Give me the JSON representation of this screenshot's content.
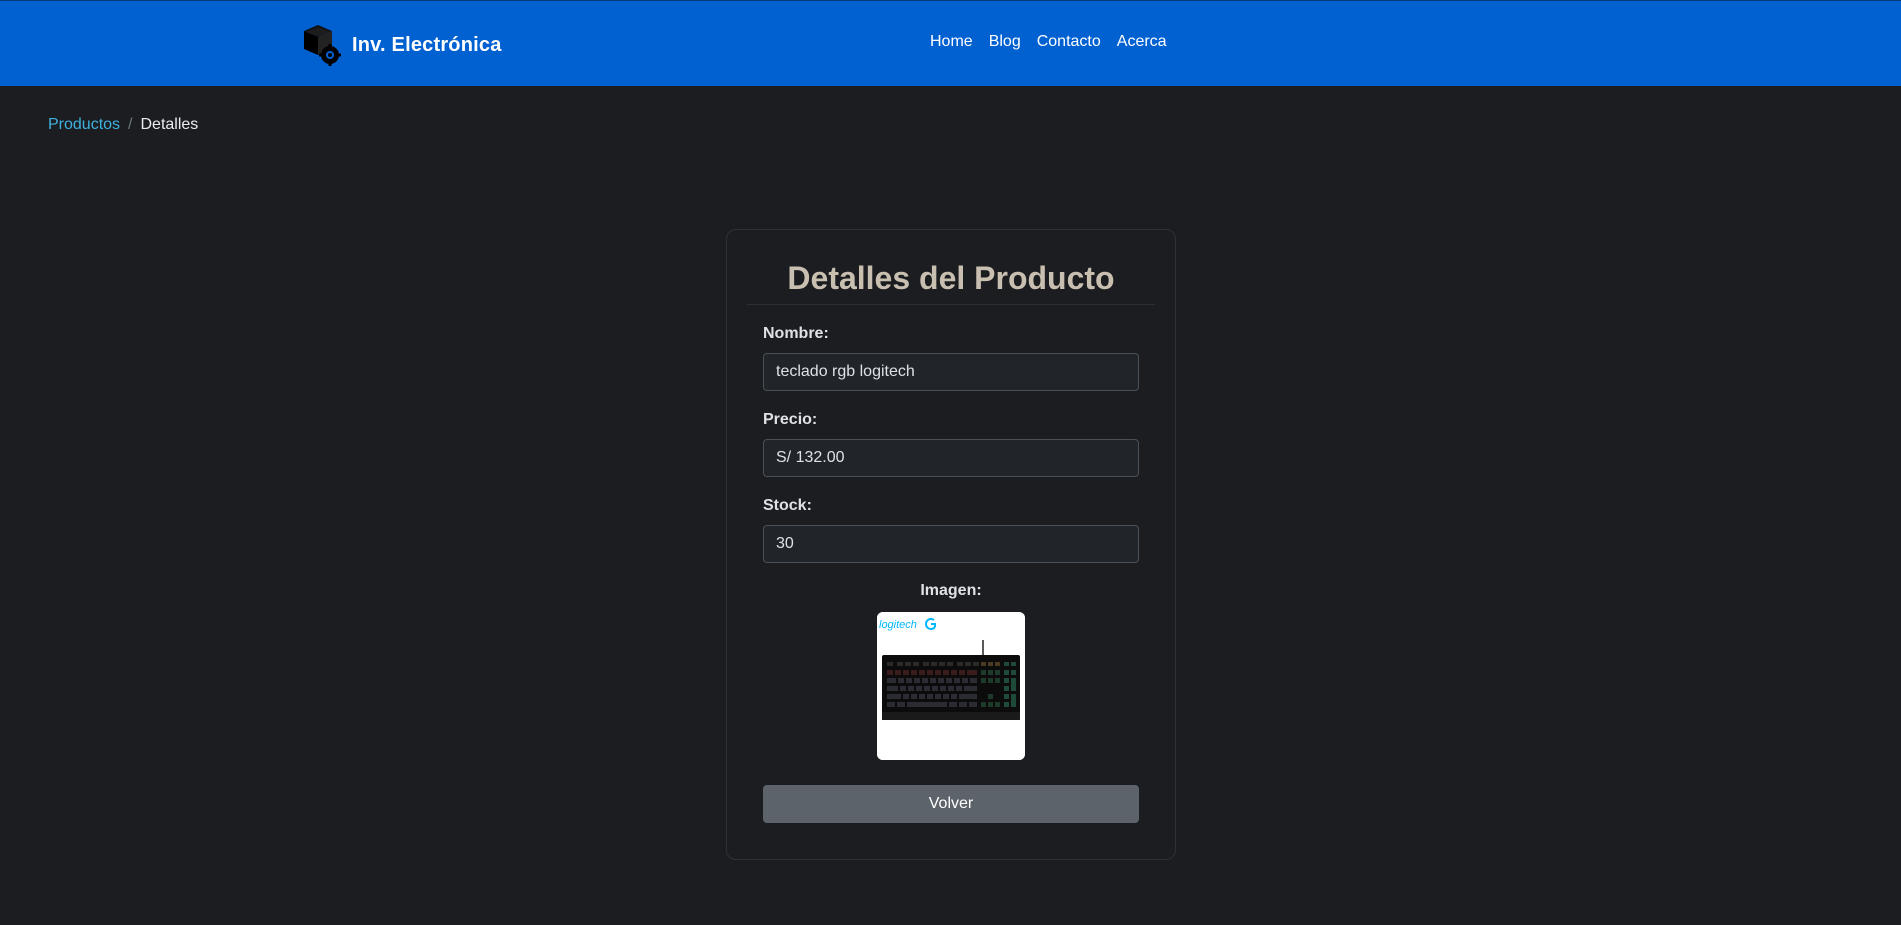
{
  "navbar": {
    "brand": "Inv. Electrónica",
    "links": [
      "Home",
      "Blog",
      "Contacto",
      "Acerca"
    ],
    "background": "#0161d1"
  },
  "breadcrumb": {
    "parent": "Productos",
    "separator": "/",
    "current": "Detalles"
  },
  "card": {
    "title": "Detalles del Producto",
    "fields": {
      "name_label": "Nombre:",
      "name_value": "teclado rgb logitech",
      "price_label": "Precio:",
      "price_value": "S/ 132.00",
      "stock_label": "Stock:",
      "stock_value": "30"
    },
    "image_label": "Imagen:",
    "image": {
      "logo_text": "logitech",
      "subject": "rgb-mechanical-keyboard"
    },
    "back_button": "Volver"
  },
  "colors": {
    "page_background": "#1b1d20",
    "link": "#3fb1e0",
    "title": "#c9bfb1",
    "button": "#5c636a"
  }
}
